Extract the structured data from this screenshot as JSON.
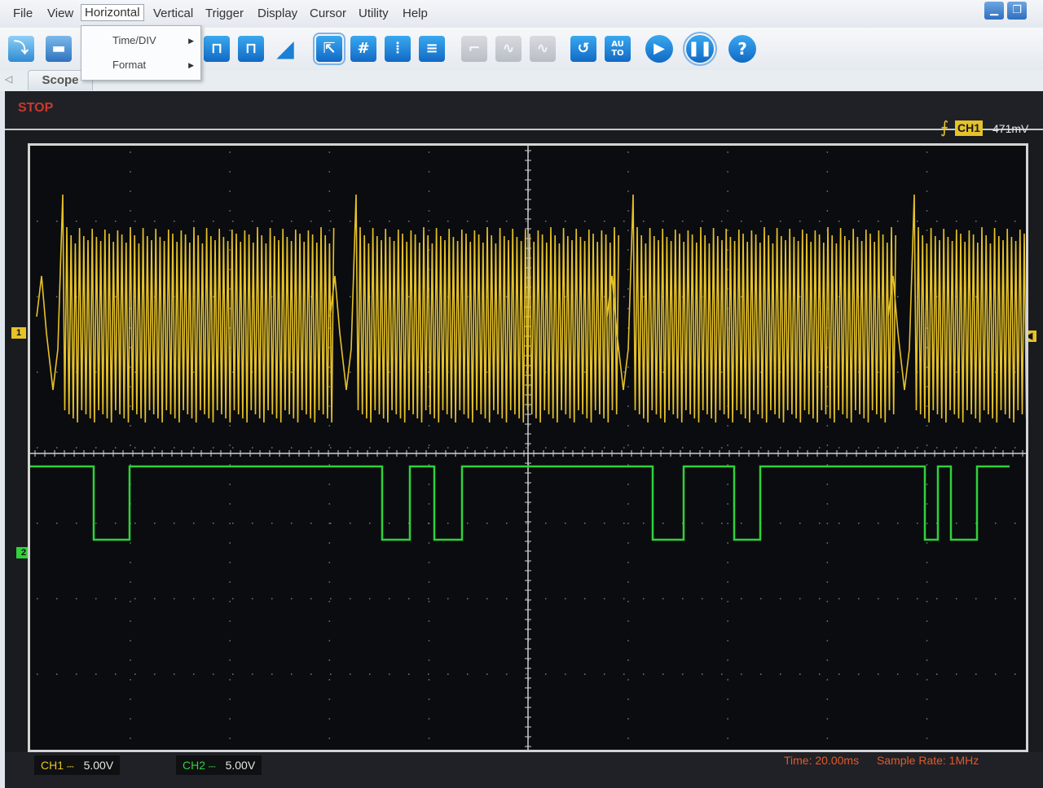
{
  "menu": {
    "items": [
      "File",
      "View",
      "Horizontal",
      "Vertical",
      "Trigger",
      "Display",
      "Cursor",
      "Utility",
      "Help"
    ],
    "active": "Horizontal",
    "dropdown": [
      {
        "label": "Time/DIV",
        "has_submenu": true
      },
      {
        "label": "Format",
        "has_submenu": true
      }
    ]
  },
  "window_controls": {
    "minimize_icon": "minimize-icon",
    "restore_icon": "restore-icon"
  },
  "toolbar": {
    "buttons": [
      {
        "name": "open-button",
        "icon": "folder-icon"
      },
      {
        "name": "save-button",
        "icon": "disk-icon"
      },
      {
        "name": "pulse-rising-button",
        "icon": "pulse-icon"
      },
      {
        "name": "pulse-falling-button",
        "icon": "pulse-alt-icon"
      },
      {
        "name": "ramp-button",
        "icon": "ramp-icon"
      },
      {
        "name": "select-cursor-button",
        "icon": "pointer-icon"
      },
      {
        "name": "grid-button",
        "icon": "grid-icon"
      },
      {
        "name": "vertical-cursor-button",
        "icon": "vertical-cursor-icon"
      },
      {
        "name": "horizontal-cursor-button",
        "icon": "horizontal-cursor-icon"
      },
      {
        "name": "step-button",
        "icon": "step-icon"
      },
      {
        "name": "wave-button",
        "icon": "wave-icon"
      },
      {
        "name": "sine-button",
        "icon": "sine-icon"
      },
      {
        "name": "refresh-button",
        "icon": "refresh-icon"
      },
      {
        "name": "auto-button",
        "icon": "auto-icon",
        "label_top": "AU",
        "label_bottom": "TO"
      },
      {
        "name": "run-button",
        "icon": "play-icon"
      },
      {
        "name": "pause-button",
        "icon": "pause-icon"
      },
      {
        "name": "help-button",
        "icon": "help-icon",
        "label": "?"
      }
    ]
  },
  "tab": {
    "label": "Scope"
  },
  "status": {
    "state": "STOP"
  },
  "trigger": {
    "channel": "CH1",
    "level": "471mV",
    "icon": "rising-edge-icon"
  },
  "channels": [
    {
      "name": "CH1",
      "coupling_icon": "dc-coupling-icon",
      "scale": "5.00V",
      "color": "#e6c229"
    },
    {
      "name": "CH2",
      "coupling_icon": "dc-coupling-icon",
      "scale": "5.00V",
      "color": "#2fd23c"
    }
  ],
  "markers": {
    "ch1_label": "1",
    "ch2_label": "2"
  },
  "acquisition": {
    "time_label": "Time: 20.00ms",
    "rate_label": "Sample Rate: 1MHz"
  },
  "colors": {
    "ch1": "#e6c229",
    "ch2": "#2fd23c",
    "stop": "#c9392c",
    "info": "#e25a2b",
    "toolbar_blue": "#1a7fd6"
  }
}
